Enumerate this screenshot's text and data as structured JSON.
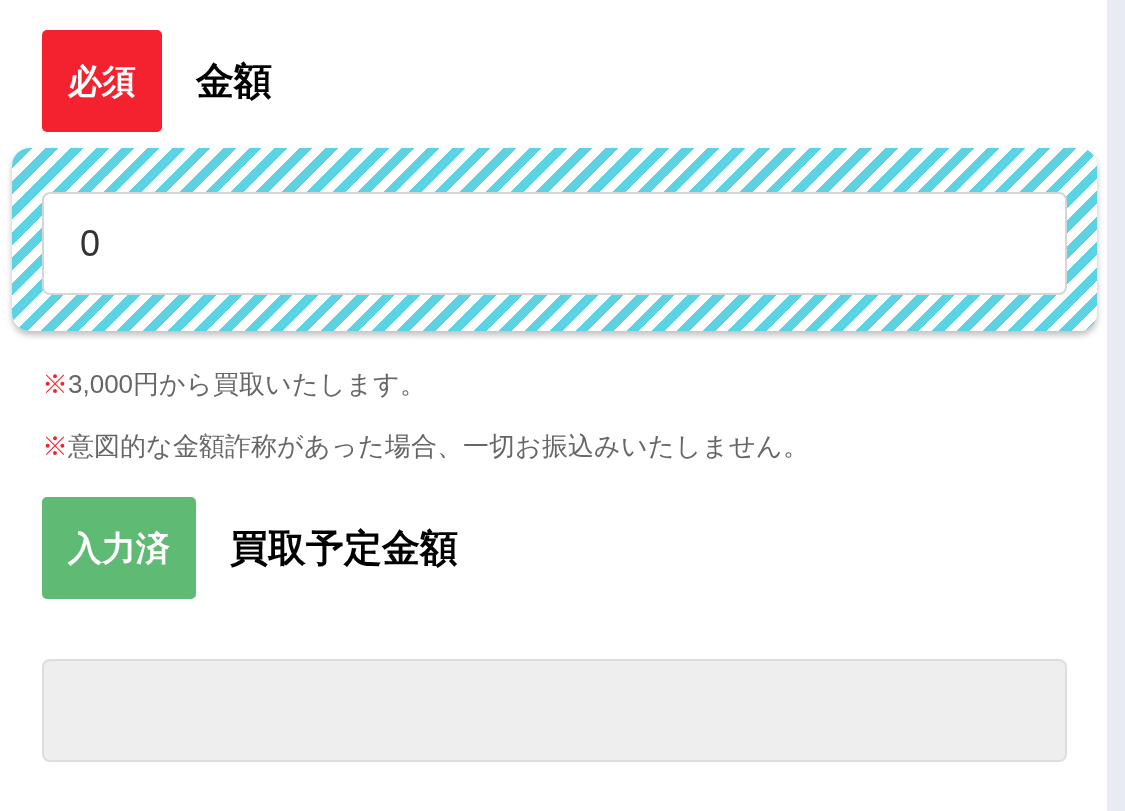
{
  "sections": [
    {
      "badge": {
        "kind": "required",
        "label": "必須"
      },
      "label": "金額",
      "field": {
        "value": "0",
        "highlighted": true,
        "disabled": false
      },
      "notes": [
        {
          "mark": "※",
          "text": "3,000円から買取いたします。"
        },
        {
          "mark": "※",
          "text": "意図的な金額詐称があった場合、一切お振込みいたしません。"
        }
      ]
    },
    {
      "badge": {
        "kind": "filled",
        "label": "入力済"
      },
      "label": "買取予定金額",
      "field": {
        "highlighted": false,
        "disabled": true
      }
    }
  ]
}
